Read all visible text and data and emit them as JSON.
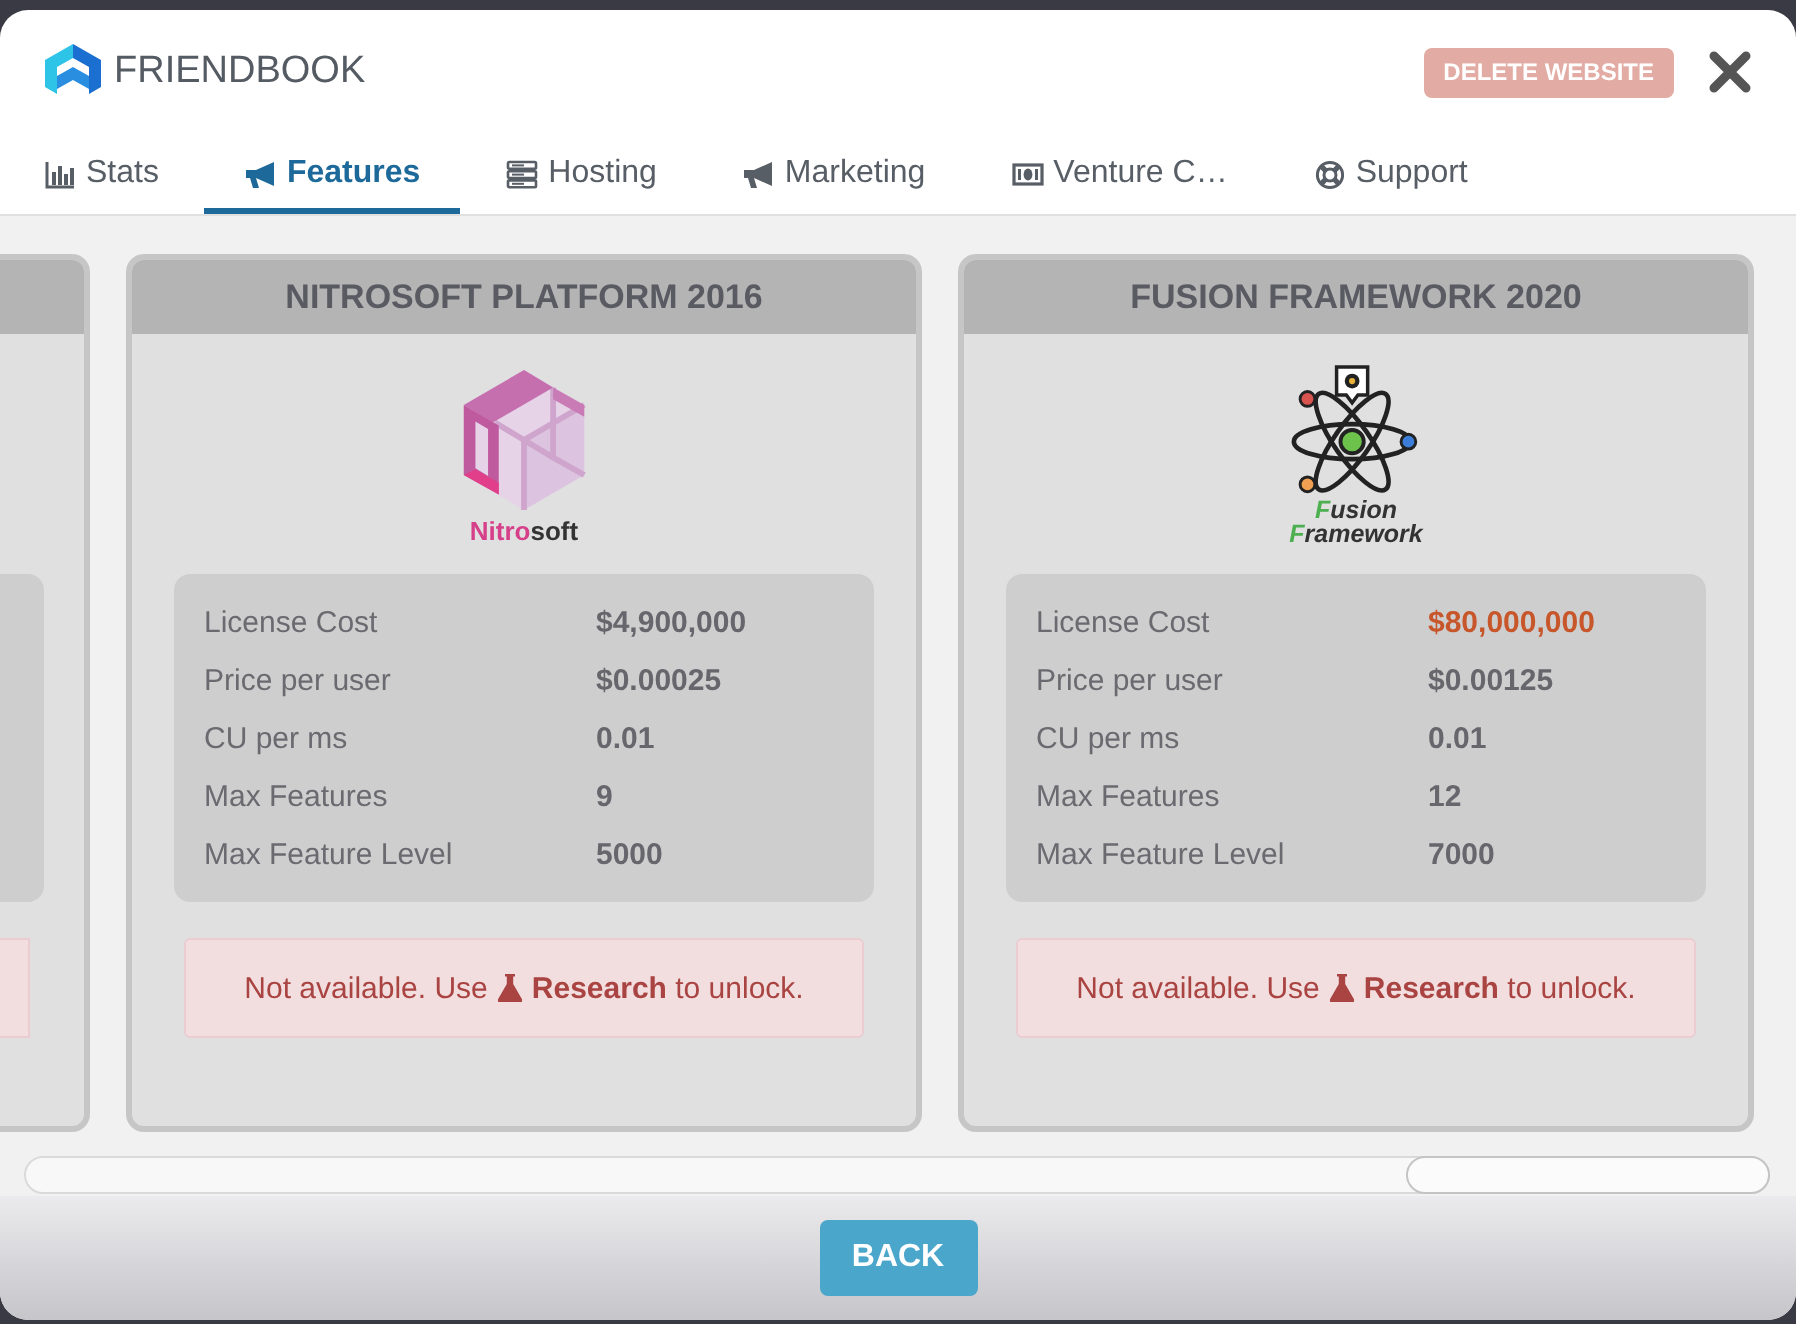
{
  "header": {
    "title": "FRIENDBOOK",
    "delete_button": {
      "label": "DELETE WEBSITE",
      "disabled": true
    }
  },
  "tabs": [
    {
      "label": "Stats",
      "selected": false
    },
    {
      "label": "Features",
      "selected": true
    },
    {
      "label": "Hosting",
      "selected": false
    },
    {
      "label": "Marketing",
      "selected": false
    },
    {
      "label": "Venture C…",
      "selected": false
    },
    {
      "label": "Support",
      "selected": false
    }
  ],
  "cards": [
    {
      "kind": "clipped"
    },
    {
      "kind": "full",
      "title": "NITROSOFT PLATFORM 2016",
      "logo_lines": [
        [
          {
            "text": "Nitro",
            "accent": true
          },
          {
            "text": "soft",
            "accent": false
          }
        ]
      ],
      "stats": [
        {
          "label": "License Cost",
          "value": "$4,900,000",
          "alert": false
        },
        {
          "label": "Price per user",
          "value": "$0.00025",
          "alert": false
        },
        {
          "label": "CU per ms",
          "value": "0.01",
          "alert": false
        },
        {
          "label": "Max Features",
          "value": "9",
          "alert": false
        },
        {
          "label": "Max Feature Level",
          "value": "5000",
          "alert": false
        }
      ],
      "notice": {
        "before": "Not available. Use",
        "after": "**Research** to unlock."
      }
    },
    {
      "kind": "full",
      "title": "FUSION FRAMEWORK 2020",
      "logo_lines": [
        [
          {
            "text": "F",
            "accent": true
          },
          {
            "text": "usion",
            "accent": false
          }
        ],
        [
          {
            "text": "F",
            "accent": true
          },
          {
            "text": "ramework",
            "accent": false
          }
        ]
      ],
      "stats": [
        {
          "label": "License Cost",
          "value": "$80,000,000",
          "alert": true
        },
        {
          "label": "Price per user",
          "value": "$0.00125",
          "alert": false
        },
        {
          "label": "CU per ms",
          "value": "0.01",
          "alert": false
        },
        {
          "label": "Max Features",
          "value": "12",
          "alert": false
        },
        {
          "label": "Max Feature Level",
          "value": "7000",
          "alert": false
        }
      ],
      "notice": {
        "before": "Not available. Use",
        "after": "**Research** to unlock."
      }
    }
  ],
  "footer": {
    "back_button": "BACK"
  }
}
